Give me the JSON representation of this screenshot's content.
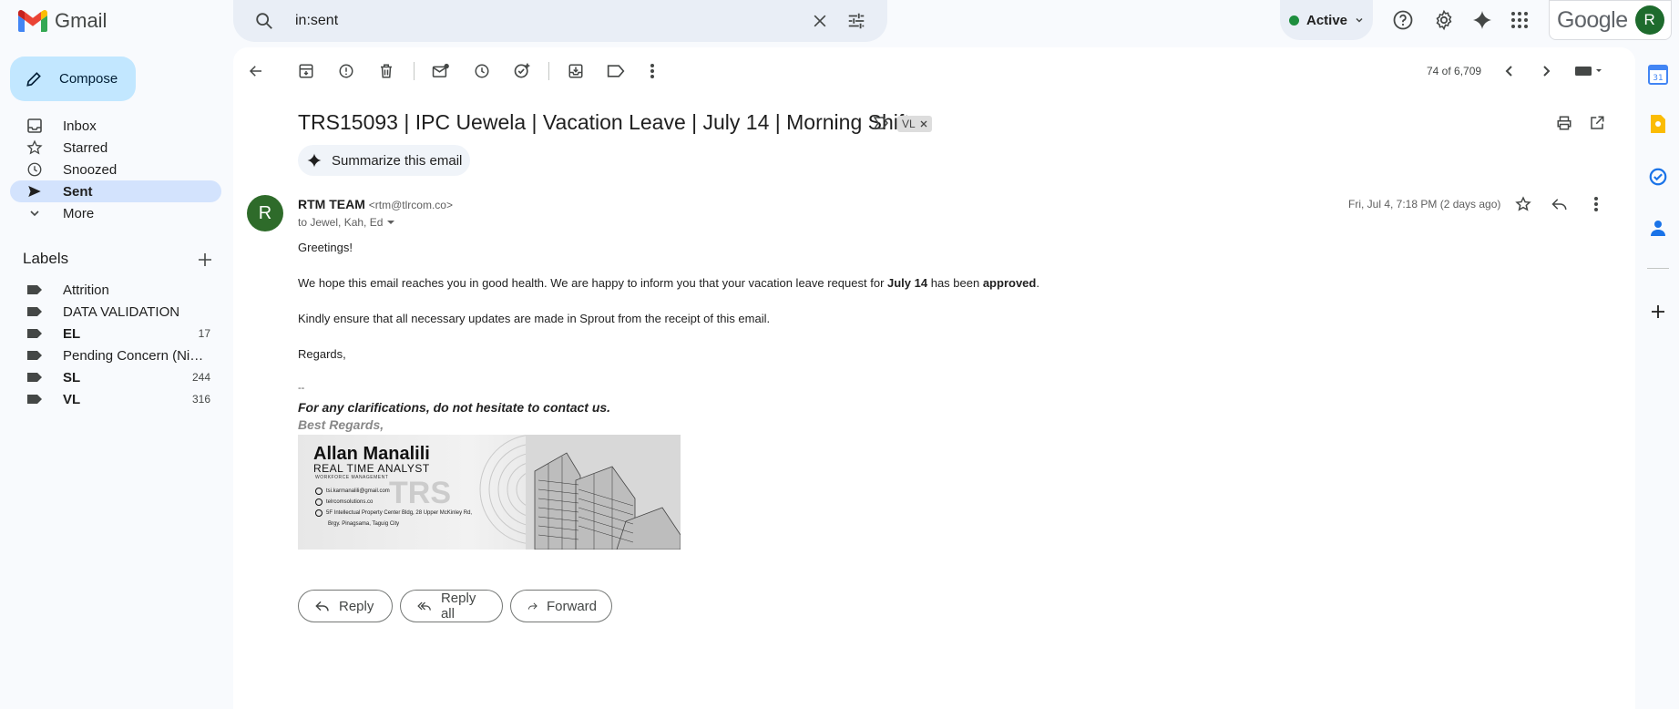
{
  "app": {
    "name": "Gmail"
  },
  "search": {
    "query": "in:sent"
  },
  "status": {
    "label": "Active"
  },
  "brand": {
    "google": "Google",
    "avatar_letter": "R"
  },
  "sidebar": {
    "compose_label": "Compose",
    "items": [
      {
        "label": "Inbox",
        "icon": "inbox-icon"
      },
      {
        "label": "Starred",
        "icon": "star-icon"
      },
      {
        "label": "Snoozed",
        "icon": "clock-icon"
      },
      {
        "label": "Sent",
        "icon": "send-icon",
        "selected": true
      },
      {
        "label": "More",
        "icon": "chevron-down-icon"
      }
    ],
    "labels_heading": "Labels",
    "labels": [
      {
        "name": "Attrition",
        "count": ""
      },
      {
        "name": "DATA VALIDATION",
        "count": ""
      },
      {
        "name": "EL",
        "count": "17"
      },
      {
        "name": "Pending Concern (Night ...",
        "count": ""
      },
      {
        "name": "SL",
        "count": "244"
      },
      {
        "name": "VL",
        "count": "316"
      }
    ]
  },
  "toolbar": {
    "pagination": "74 of 6,709"
  },
  "email": {
    "subject": "TRS15093 | IPC Uewela | Vacation Leave | July 14 | Morning Shift",
    "label_chip": "VL",
    "summarize_label": "Summarize this email",
    "sender_initial": "R",
    "sender_name": "RTM TEAM",
    "sender_email": "<rtm@tlrcom.co>",
    "recipients": "to Jewel, Kah, Ed",
    "date": "Fri, Jul 4, 7:18 PM (2 days ago)",
    "greeting": "Greetings!",
    "p1_start": "We hope this email reaches you in good health. We are happy to inform you that your vacation leave request for ",
    "p1_date": "July 14",
    "p1_mid": " has been ",
    "p1_status": "approved",
    "p1_end": ".",
    "p2": "Kindly ensure that all necessary updates are made in Sprout from the receipt of this email.",
    "closing": "Regards,",
    "dashes": "--",
    "sig_line1": "For any clarifications, do not hesitate to contact us.",
    "sig_line2": "Best Regards,",
    "card": {
      "name": "Allan Manalili",
      "role": "REAL TIME ANALYST",
      "dept": "WORKFORCE MANAGEMENT",
      "email": "tsi.karmanalili@gmail.com",
      "web": "telrcomsolutions.co",
      "addr1": "5F Intellectual Property Center Bldg, 28 Upper McKinley Rd,",
      "addr2": "Brgy. Pinagsama, Taguig City",
      "watermark": "TRS"
    }
  },
  "actions": {
    "reply": "Reply",
    "reply_all": "Reply all",
    "forward": "Forward"
  }
}
